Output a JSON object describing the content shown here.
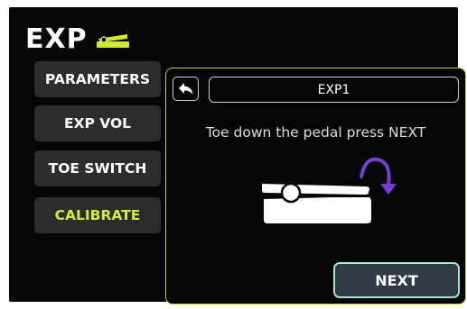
{
  "header": {
    "title": "EXP",
    "icon": "expression-pedal-icon"
  },
  "sidebar": {
    "items": [
      {
        "label": "PARAMETERS",
        "active": false
      },
      {
        "label": "EXP VOL",
        "active": false
      },
      {
        "label": "TOE SWITCH",
        "active": false
      },
      {
        "label": "CALIBRATE",
        "active": true
      }
    ]
  },
  "panel": {
    "back_icon": "back-arrow-icon",
    "title": "EXP1",
    "instruction": "Toe down the pedal press NEXT",
    "graphic": "pedal-toe-down-icon",
    "next_label": "NEXT"
  },
  "colors": {
    "accent": "#d3ec3c",
    "panel_border": "#b8d43a",
    "next_border": "#9fe6d2",
    "arrow_purple": "#7b3bd6"
  }
}
